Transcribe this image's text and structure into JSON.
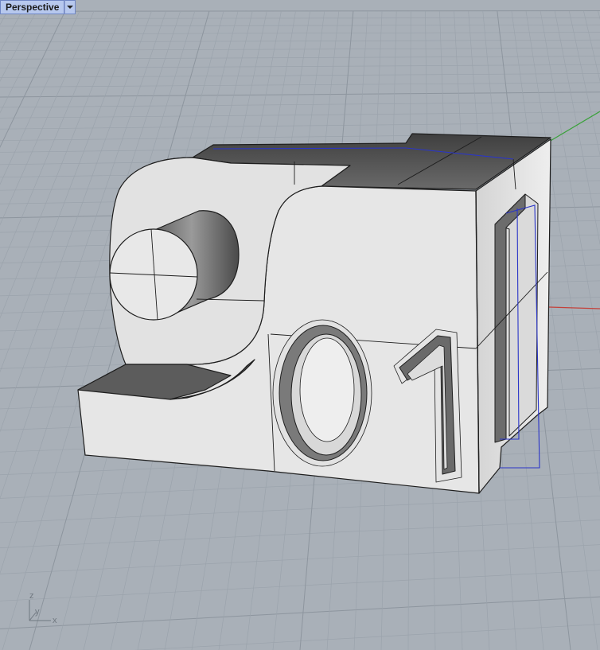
{
  "viewport": {
    "title": "Perspective",
    "menu_icon": "chevron-down-icon"
  },
  "axis_widget": {
    "z_label": "z",
    "y_label": "y",
    "x_label": "x"
  },
  "scene": {
    "front_digits": [
      "0",
      "1"
    ],
    "colors": {
      "background": "#a9b0b8",
      "grid_minor": "#9ba3ac",
      "grid_major": "#8d959e",
      "x_axis": "#c4413a",
      "y_axis": "#3aa13a",
      "model_face": "#e4e4e4",
      "model_dark": "#4f4f4f",
      "edge": "#1e1e1e",
      "hidden_edge": "#2a35c8"
    }
  }
}
